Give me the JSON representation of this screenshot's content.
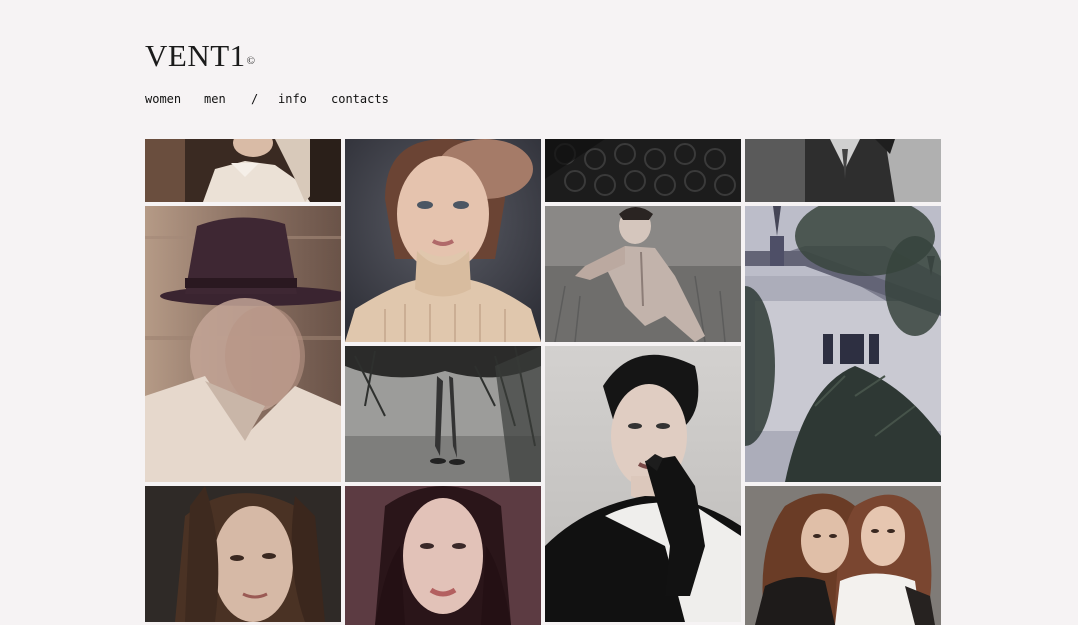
{
  "site": {
    "logo_text": "VENT1",
    "logo_mark": "©"
  },
  "nav": {
    "items": [
      "women",
      "men",
      "/",
      "info",
      "contacts"
    ]
  },
  "gallery": {
    "tiles": [
      {
        "subject": "woman in white collared shirt, hand at head"
      },
      {
        "subject": "woman with beret and cream cable-knit turtleneck"
      },
      {
        "subject": "dark textured knit fabric"
      },
      {
        "subject": "man in vest and shirt, black and white"
      },
      {
        "subject": "man in dark fedora, motion blur"
      },
      {
        "subject": "man in patterned shirt among grass"
      },
      {
        "subject": "white house with turret among trees"
      },
      {
        "subject": "legs walking under pine branches"
      },
      {
        "subject": "woman in black leather glove, white sweater"
      },
      {
        "subject": "woman with long brown hair"
      },
      {
        "subject": "woman with dark hair on maroon background"
      },
      {
        "subject": "two women with long wavy hair"
      }
    ]
  },
  "colors": {
    "background": "#f6f3f4",
    "text": "#111111"
  }
}
